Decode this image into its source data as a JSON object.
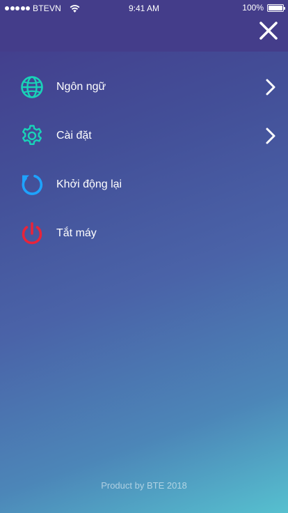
{
  "status_bar": {
    "carrier": "BTEVN",
    "time": "9:41 AM",
    "battery": "100%",
    "signal_bars": 5,
    "battery_level": 1.0
  },
  "header": {
    "close_icon": "close-icon"
  },
  "menu": {
    "items": [
      {
        "label": "Ngôn ngữ",
        "icon": "globe-icon",
        "icon_color": "#19d3b8",
        "has_chevron": true
      },
      {
        "label": "Cài đặt",
        "icon": "gear-icon",
        "icon_color": "#19d3b8",
        "has_chevron": true
      },
      {
        "label": "Khởi động lại",
        "icon": "restart-icon",
        "icon_color": "#1ea3ff",
        "has_chevron": false
      },
      {
        "label": "Tắt máy",
        "icon": "power-icon",
        "icon_color": "#e8243a",
        "has_chevron": false
      }
    ]
  },
  "footer": {
    "text": "Product by BTE 2018"
  },
  "colors": {
    "header_bg": "#443d8a",
    "gradient_top": "#433a8a",
    "gradient_bottom": "#56c0cf"
  }
}
